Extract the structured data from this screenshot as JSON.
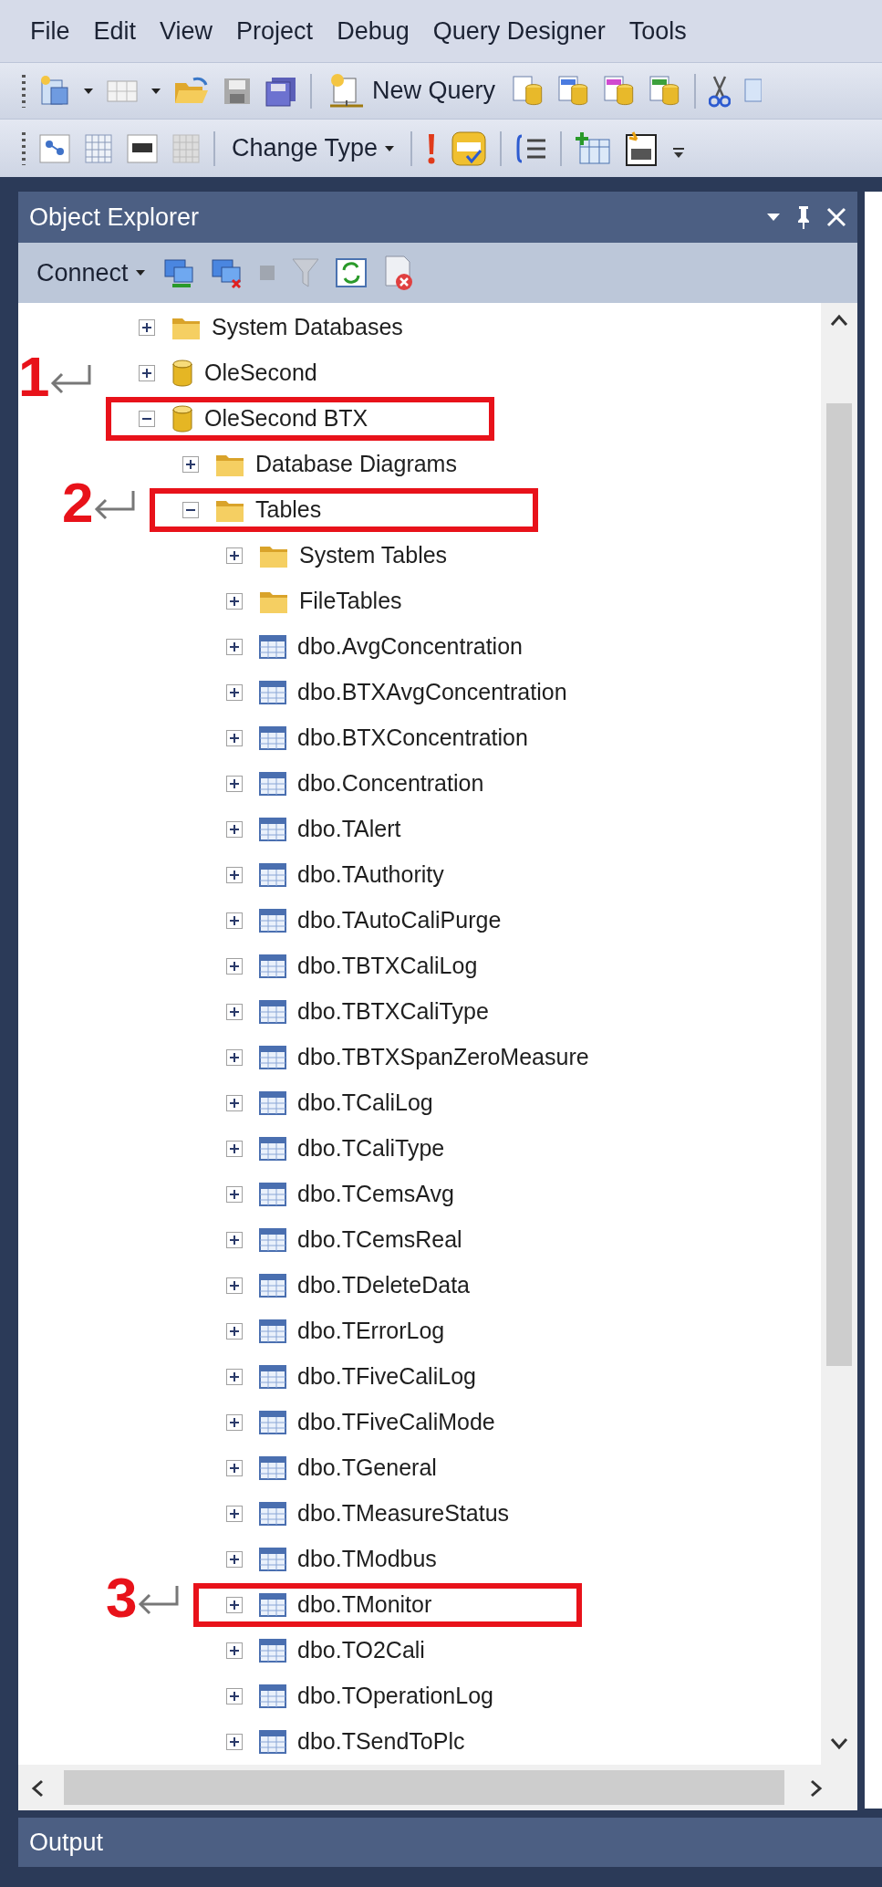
{
  "menu": [
    "File",
    "Edit",
    "View",
    "Project",
    "Debug",
    "Query Designer",
    "Tools"
  ],
  "toolbar_1": {
    "new_query": "New Query"
  },
  "toolbar_2": {
    "change_type": "Change Type"
  },
  "object_explorer": {
    "title": "Object Explorer",
    "connect": "Connect",
    "tree": [
      {
        "label": "System Databases",
        "kind": "folder",
        "expanded": false,
        "highlighted": false
      },
      {
        "label": "OleSecond",
        "kind": "database",
        "expanded": false,
        "highlighted": false
      },
      {
        "label": "OleSecond BTX",
        "kind": "database",
        "expanded": true,
        "highlighted": true,
        "marker": "1",
        "children": [
          {
            "label": "Database Diagrams",
            "kind": "folder",
            "expanded": false,
            "highlighted": false
          },
          {
            "label": "Tables",
            "kind": "folder",
            "expanded": true,
            "highlighted": true,
            "marker": "2",
            "children": [
              {
                "label": "System Tables",
                "kind": "folder",
                "expanded": false,
                "highlighted": false
              },
              {
                "label": "FileTables",
                "kind": "folder",
                "expanded": false,
                "highlighted": false
              },
              {
                "label": "dbo.AvgConcentration",
                "kind": "table",
                "expanded": false,
                "highlighted": false
              },
              {
                "label": "dbo.BTXAvgConcentration",
                "kind": "table",
                "expanded": false,
                "highlighted": false
              },
              {
                "label": "dbo.BTXConcentration",
                "kind": "table",
                "expanded": false,
                "highlighted": false
              },
              {
                "label": "dbo.Concentration",
                "kind": "table",
                "expanded": false,
                "highlighted": false
              },
              {
                "label": "dbo.TAlert",
                "kind": "table",
                "expanded": false,
                "highlighted": false
              },
              {
                "label": "dbo.TAuthority",
                "kind": "table",
                "expanded": false,
                "highlighted": false
              },
              {
                "label": "dbo.TAutoCaliPurge",
                "kind": "table",
                "expanded": false,
                "highlighted": false
              },
              {
                "label": "dbo.TBTXCaliLog",
                "kind": "table",
                "expanded": false,
                "highlighted": false
              },
              {
                "label": "dbo.TBTXCaliType",
                "kind": "table",
                "expanded": false,
                "highlighted": false
              },
              {
                "label": "dbo.TBTXSpanZeroMeasure",
                "kind": "table",
                "expanded": false,
                "highlighted": false
              },
              {
                "label": "dbo.TCaliLog",
                "kind": "table",
                "expanded": false,
                "highlighted": false
              },
              {
                "label": "dbo.TCaliType",
                "kind": "table",
                "expanded": false,
                "highlighted": false
              },
              {
                "label": "dbo.TCemsAvg",
                "kind": "table",
                "expanded": false,
                "highlighted": false
              },
              {
                "label": "dbo.TCemsReal",
                "kind": "table",
                "expanded": false,
                "highlighted": false
              },
              {
                "label": "dbo.TDeleteData",
                "kind": "table",
                "expanded": false,
                "highlighted": false
              },
              {
                "label": "dbo.TErrorLog",
                "kind": "table",
                "expanded": false,
                "highlighted": false
              },
              {
                "label": "dbo.TFiveCaliLog",
                "kind": "table",
                "expanded": false,
                "highlighted": false
              },
              {
                "label": "dbo.TFiveCaliMode",
                "kind": "table",
                "expanded": false,
                "highlighted": false
              },
              {
                "label": "dbo.TGeneral",
                "kind": "table",
                "expanded": false,
                "highlighted": false
              },
              {
                "label": "dbo.TMeasureStatus",
                "kind": "table",
                "expanded": false,
                "highlighted": false
              },
              {
                "label": "dbo.TModbus",
                "kind": "table",
                "expanded": false,
                "highlighted": false
              },
              {
                "label": "dbo.TMonitor",
                "kind": "table",
                "expanded": false,
                "highlighted": true,
                "marker": "3"
              },
              {
                "label": "dbo.TO2Cali",
                "kind": "table",
                "expanded": false,
                "highlighted": false
              },
              {
                "label": "dbo.TOperationLog",
                "kind": "table",
                "expanded": false,
                "highlighted": false
              },
              {
                "label": "dbo.TSendToPlc",
                "kind": "table",
                "expanded": false,
                "highlighted": false
              }
            ]
          }
        ]
      }
    ]
  },
  "output": {
    "title": "Output"
  }
}
